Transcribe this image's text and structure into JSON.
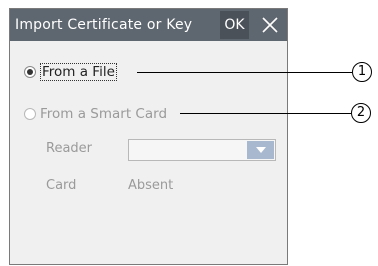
{
  "dialog": {
    "title": "Import Certificate or Key",
    "ok_label": "OK",
    "options": {
      "from_file": "From a File",
      "from_smart_card": "From a Smart Card"
    },
    "reader_label": "Reader",
    "reader_value": "",
    "card_label": "Card",
    "card_value": "Absent"
  },
  "callouts": [
    "1",
    "2"
  ],
  "icons": {
    "close": "close-icon",
    "dropdown": "chevron-down-icon"
  }
}
